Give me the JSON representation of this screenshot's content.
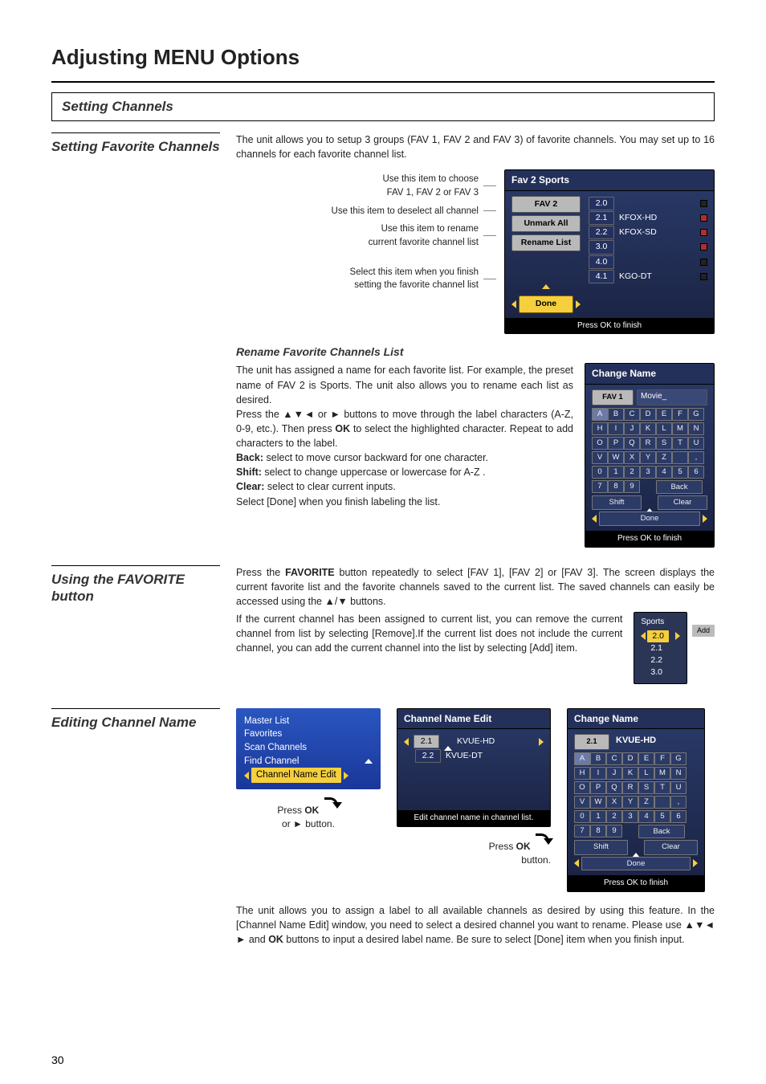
{
  "page_number": "30",
  "h1": "Adjusting MENU Options",
  "section_bar": "Setting Channels",
  "sec1": {
    "lead": "Setting Favorite Channels",
    "intro": "The unit allows you to setup 3 groups (FAV 1, FAV 2 and FAV 3) of favorite channels. You may set up to 16 channels for each favorite channel list.",
    "p1a": "Use this item to choose",
    "p1b": "FAV 1, FAV 2 or FAV 3",
    "p2": "Use this item to deselect all channel",
    "p3a": "Use this item to rename",
    "p3b": "current favorite channel list",
    "p4a": "Select this item when you finish",
    "p4b": "setting the favorite channel list",
    "panel_title": "Fav 2 Sports",
    "btn_fav2": "FAV 2",
    "btn_unmark": "Unmark All",
    "btn_rename": "Rename List",
    "btn_done": "Done",
    "ch": [
      {
        "n": "2.0",
        "name": "",
        "on": false
      },
      {
        "n": "2.1",
        "name": "KFOX-HD",
        "on": true
      },
      {
        "n": "2.2",
        "name": "KFOX-SD",
        "on": true
      },
      {
        "n": "3.0",
        "name": "",
        "on": true
      },
      {
        "n": "4.0",
        "name": "",
        "on": false
      },
      {
        "n": "4.1",
        "name": "KGO-DT",
        "on": false
      }
    ],
    "footer": "Press OK to finish",
    "rename_h": "Rename Favorite Channels List",
    "rename_body1": "The unit has assigned a name for each favorite list. For example, the preset name of FAV 2 is Sports. The unit also allows you to rename each list as desired.",
    "rename_body2": "Press the ▲▼◄ or ► buttons to move through the label characters (A-Z, 0-9, etc.). Then press ",
    "rename_ok": "OK",
    "rename_body2b": " to select the highlighted character. Repeat to add characters to the label.",
    "back_l": "Back:",
    "back_t": " select to move cursor backward for one character.",
    "shift_l": "Shift:",
    "shift_t": " select to change uppercase or lowercase for A-Z .",
    "clear_l": "Clear:",
    "clear_t": " select to clear current inputs.",
    "rename_body3": "Select [Done] when you finish labeling the list.",
    "cn_title": "Change Name",
    "cn_fav1": "FAV 1",
    "cn_input": "Movie_",
    "cn_back": "Back",
    "cn_shift": "Shift",
    "cn_clear": "Clear",
    "cn_done": "Done",
    "cn_foot": "Press OK to finish",
    "keys1": [
      "A",
      "B",
      "C",
      "D",
      "E",
      "F",
      "G"
    ],
    "keys2": [
      "H",
      "I",
      "J",
      "K",
      "L",
      "M",
      "N"
    ],
    "keys3": [
      "O",
      "P",
      "Q",
      "R",
      "S",
      "T",
      "U"
    ],
    "keys4": [
      "V",
      "W",
      "X",
      "Y",
      "Z",
      "",
      ","
    ],
    "keys5": [
      "0",
      "1",
      "2",
      "3",
      "4",
      "5",
      "6"
    ],
    "keys6": [
      "7",
      "8",
      "9",
      "",
      "",
      "",
      ""
    ]
  },
  "sec2": {
    "lead": "Using the FAVORITE button",
    "t1a": "Press the ",
    "t1b": "FAVORITE",
    "t1c": " button repeatedly to select [FAV 1], [FAV 2] or [FAV 3]. The screen displays the current favorite list and the favorite channels saved to the current list. The saved channels can easily be accessed using the ▲/▼ buttons.",
    "t2": "If the current channel has been assigned to current list, you can remove the current channel from list by selecting [Remove].If the current list does not include the current channel, you can add the current channel into the list by selecting [Add] item.",
    "tt_title": "Sports",
    "tt_cur": "2.0",
    "tt_rows": [
      "2.1",
      "2.2",
      "3.0"
    ],
    "tt_add": "Add"
  },
  "sec3": {
    "lead": "Editing Channel Name",
    "bb_items": [
      "Master List",
      "Favorites",
      "Scan Channels",
      "Find Channel",
      "Channel Name Edit"
    ],
    "press_ok": "Press ",
    "ok": "OK",
    "or_btn": "or ► button.",
    "press_ok2": "Press ",
    "btn2": "button.",
    "cne_title": "Channel Name Edit",
    "cne_rows": [
      {
        "n": "2.1",
        "name": "KVUE-HD"
      },
      {
        "n": "2.2",
        "name": "KVUE-DT"
      }
    ],
    "cne_foot": "Edit channel name in channel list.",
    "cn2_title": "Change Name",
    "cn2_num": "2.1",
    "cn2_input": "KVUE-HD",
    "cn2_done": "Done",
    "cn2_foot": "Press OK to finish",
    "cn2_back": "Back",
    "cn2_shift": "Shift",
    "cn2_clear": "Clear",
    "keys1": [
      "A",
      "B",
      "C",
      "D",
      "E",
      "F",
      "G"
    ],
    "keys2": [
      "H",
      "I",
      "J",
      "K",
      "L",
      "M",
      "N"
    ],
    "keys3": [
      "O",
      "P",
      "Q",
      "R",
      "S",
      "T",
      "U"
    ],
    "keys4": [
      "V",
      "W",
      "X",
      "Y",
      "Z",
      "",
      ","
    ],
    "keys5": [
      "0",
      "1",
      "2",
      "3",
      "4",
      "5",
      "6"
    ],
    "keys6": [
      "7",
      "8",
      "9",
      "",
      "",
      "",
      ""
    ],
    "para": "The unit allows you to assign a label to all available channels as desired by using this feature. In the [Channel Name Edit] window, you need to select a desired channel you want to rename. Please use ▲▼◄ ► and ",
    "para_ok": "OK",
    "para2": " buttons to input a desired label name. Be sure to select [Done] item when you finish input."
  }
}
